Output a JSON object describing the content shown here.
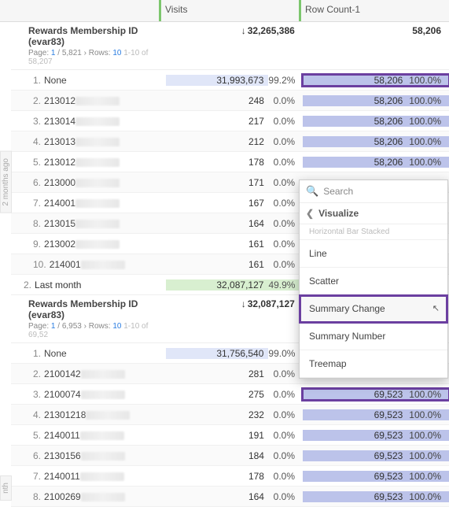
{
  "columns": {
    "visits": "Visits",
    "rowcount": "Row Count-1"
  },
  "sideTabs": {
    "t1": "2 months ago",
    "t2": "nth"
  },
  "group1": {
    "title": "Rewards Membership ID (evar83)",
    "page_label": "Page:",
    "page_current": "1",
    "page_total": "5,821",
    "rows_label": "Rows:",
    "rows_value": "10",
    "rows_range": "1-10 of 58,207",
    "visits_total": "32,265,386",
    "rc_total": "58,206",
    "rows": [
      {
        "ord": "1.",
        "name": "None",
        "redact": false,
        "visits": "31,993,673",
        "vfull": true,
        "pct": "99.2%",
        "rc": "58,206",
        "rcpct": "100.0%",
        "hl": true
      },
      {
        "ord": "2.",
        "name": "213012",
        "redact": true,
        "visits": "248",
        "vfull": false,
        "pct": "0.0%",
        "rc": "58,206",
        "rcpct": "100.0%",
        "hl": false
      },
      {
        "ord": "3.",
        "name": "213014",
        "redact": true,
        "visits": "217",
        "vfull": false,
        "pct": "0.0%",
        "rc": "58,206",
        "rcpct": "100.0%",
        "hl": false
      },
      {
        "ord": "4.",
        "name": "213013",
        "redact": true,
        "visits": "212",
        "vfull": false,
        "pct": "0.0%",
        "rc": "58,206",
        "rcpct": "100.0%",
        "hl": false
      },
      {
        "ord": "5.",
        "name": "213012",
        "redact": true,
        "visits": "178",
        "vfull": false,
        "pct": "0.0%",
        "rc": "58,206",
        "rcpct": "100.0%",
        "hl": false
      },
      {
        "ord": "6.",
        "name": "213000",
        "redact": true,
        "visits": "171",
        "vfull": false,
        "pct": "0.0%",
        "rc": "",
        "rcpct": "",
        "hl": false
      },
      {
        "ord": "7.",
        "name": "214001",
        "redact": true,
        "visits": "167",
        "vfull": false,
        "pct": "0.0%",
        "rc": "",
        "rcpct": "",
        "hl": false
      },
      {
        "ord": "8.",
        "name": "213015",
        "redact": true,
        "visits": "164",
        "vfull": false,
        "pct": "0.0%",
        "rc": "",
        "rcpct": "",
        "hl": false
      },
      {
        "ord": "9.",
        "name": "213002",
        "redact": true,
        "visits": "161",
        "vfull": false,
        "pct": "0.0%",
        "rc": "",
        "rcpct": "",
        "hl": false
      },
      {
        "ord": "10.",
        "name": "214001",
        "redact": true,
        "visits": "161",
        "vfull": false,
        "pct": "0.0%",
        "rc": "",
        "rcpct": "",
        "hl": false
      }
    ]
  },
  "monthRow": {
    "ord": "2.",
    "label": "Last month",
    "visits": "32,087,127",
    "pct": "49.9%"
  },
  "group2": {
    "title": "Rewards Membership ID (evar83)",
    "page_label": "Page:",
    "page_current": "1",
    "page_total": "6,953",
    "rows_label": "Rows:",
    "rows_value": "10",
    "rows_range": "1-10 of 69,52",
    "visits_total": "32,087,127",
    "rows": [
      {
        "ord": "1.",
        "name": "None",
        "redact": false,
        "visits": "31,756,540",
        "vfull": true,
        "pct": "99.0%",
        "rc": "",
        "rcpct": "",
        "hl": false
      },
      {
        "ord": "2.",
        "name": "2100142",
        "redact": true,
        "visits": "281",
        "vfull": false,
        "pct": "0.0%",
        "rc": "",
        "rcpct": "",
        "hl": false
      },
      {
        "ord": "3.",
        "name": "2100074",
        "redact": true,
        "visits": "275",
        "vfull": false,
        "pct": "0.0%",
        "rc": "69,523",
        "rcpct": "100.0%",
        "hl": true
      },
      {
        "ord": "4.",
        "name": "21301218",
        "redact": true,
        "visits": "232",
        "vfull": false,
        "pct": "0.0%",
        "rc": "69,523",
        "rcpct": "100.0%",
        "hl": false
      },
      {
        "ord": "5.",
        "name": "2140011",
        "redact": true,
        "visits": "191",
        "vfull": false,
        "pct": "0.0%",
        "rc": "69,523",
        "rcpct": "100.0%",
        "hl": false
      },
      {
        "ord": "6.",
        "name": "2130156",
        "redact": true,
        "visits": "184",
        "vfull": false,
        "pct": "0.0%",
        "rc": "69,523",
        "rcpct": "100.0%",
        "hl": false
      },
      {
        "ord": "7.",
        "name": "2140011",
        "redact": true,
        "visits": "178",
        "vfull": false,
        "pct": "0.0%",
        "rc": "69,523",
        "rcpct": "100.0%",
        "hl": false
      },
      {
        "ord": "8.",
        "name": "2100269",
        "redact": true,
        "visits": "164",
        "vfull": false,
        "pct": "0.0%",
        "rc": "69,523",
        "rcpct": "100.0%",
        "hl": false
      }
    ]
  },
  "contextMenu": {
    "search_placeholder": "Search",
    "visualize_label": "Visualize",
    "truncated": "Horizontal Bar Stacked",
    "items": {
      "line": "Line",
      "scatter": "Scatter",
      "summary_change": "Summary Change",
      "summary_number": "Summary Number",
      "treemap": "Treemap"
    }
  }
}
